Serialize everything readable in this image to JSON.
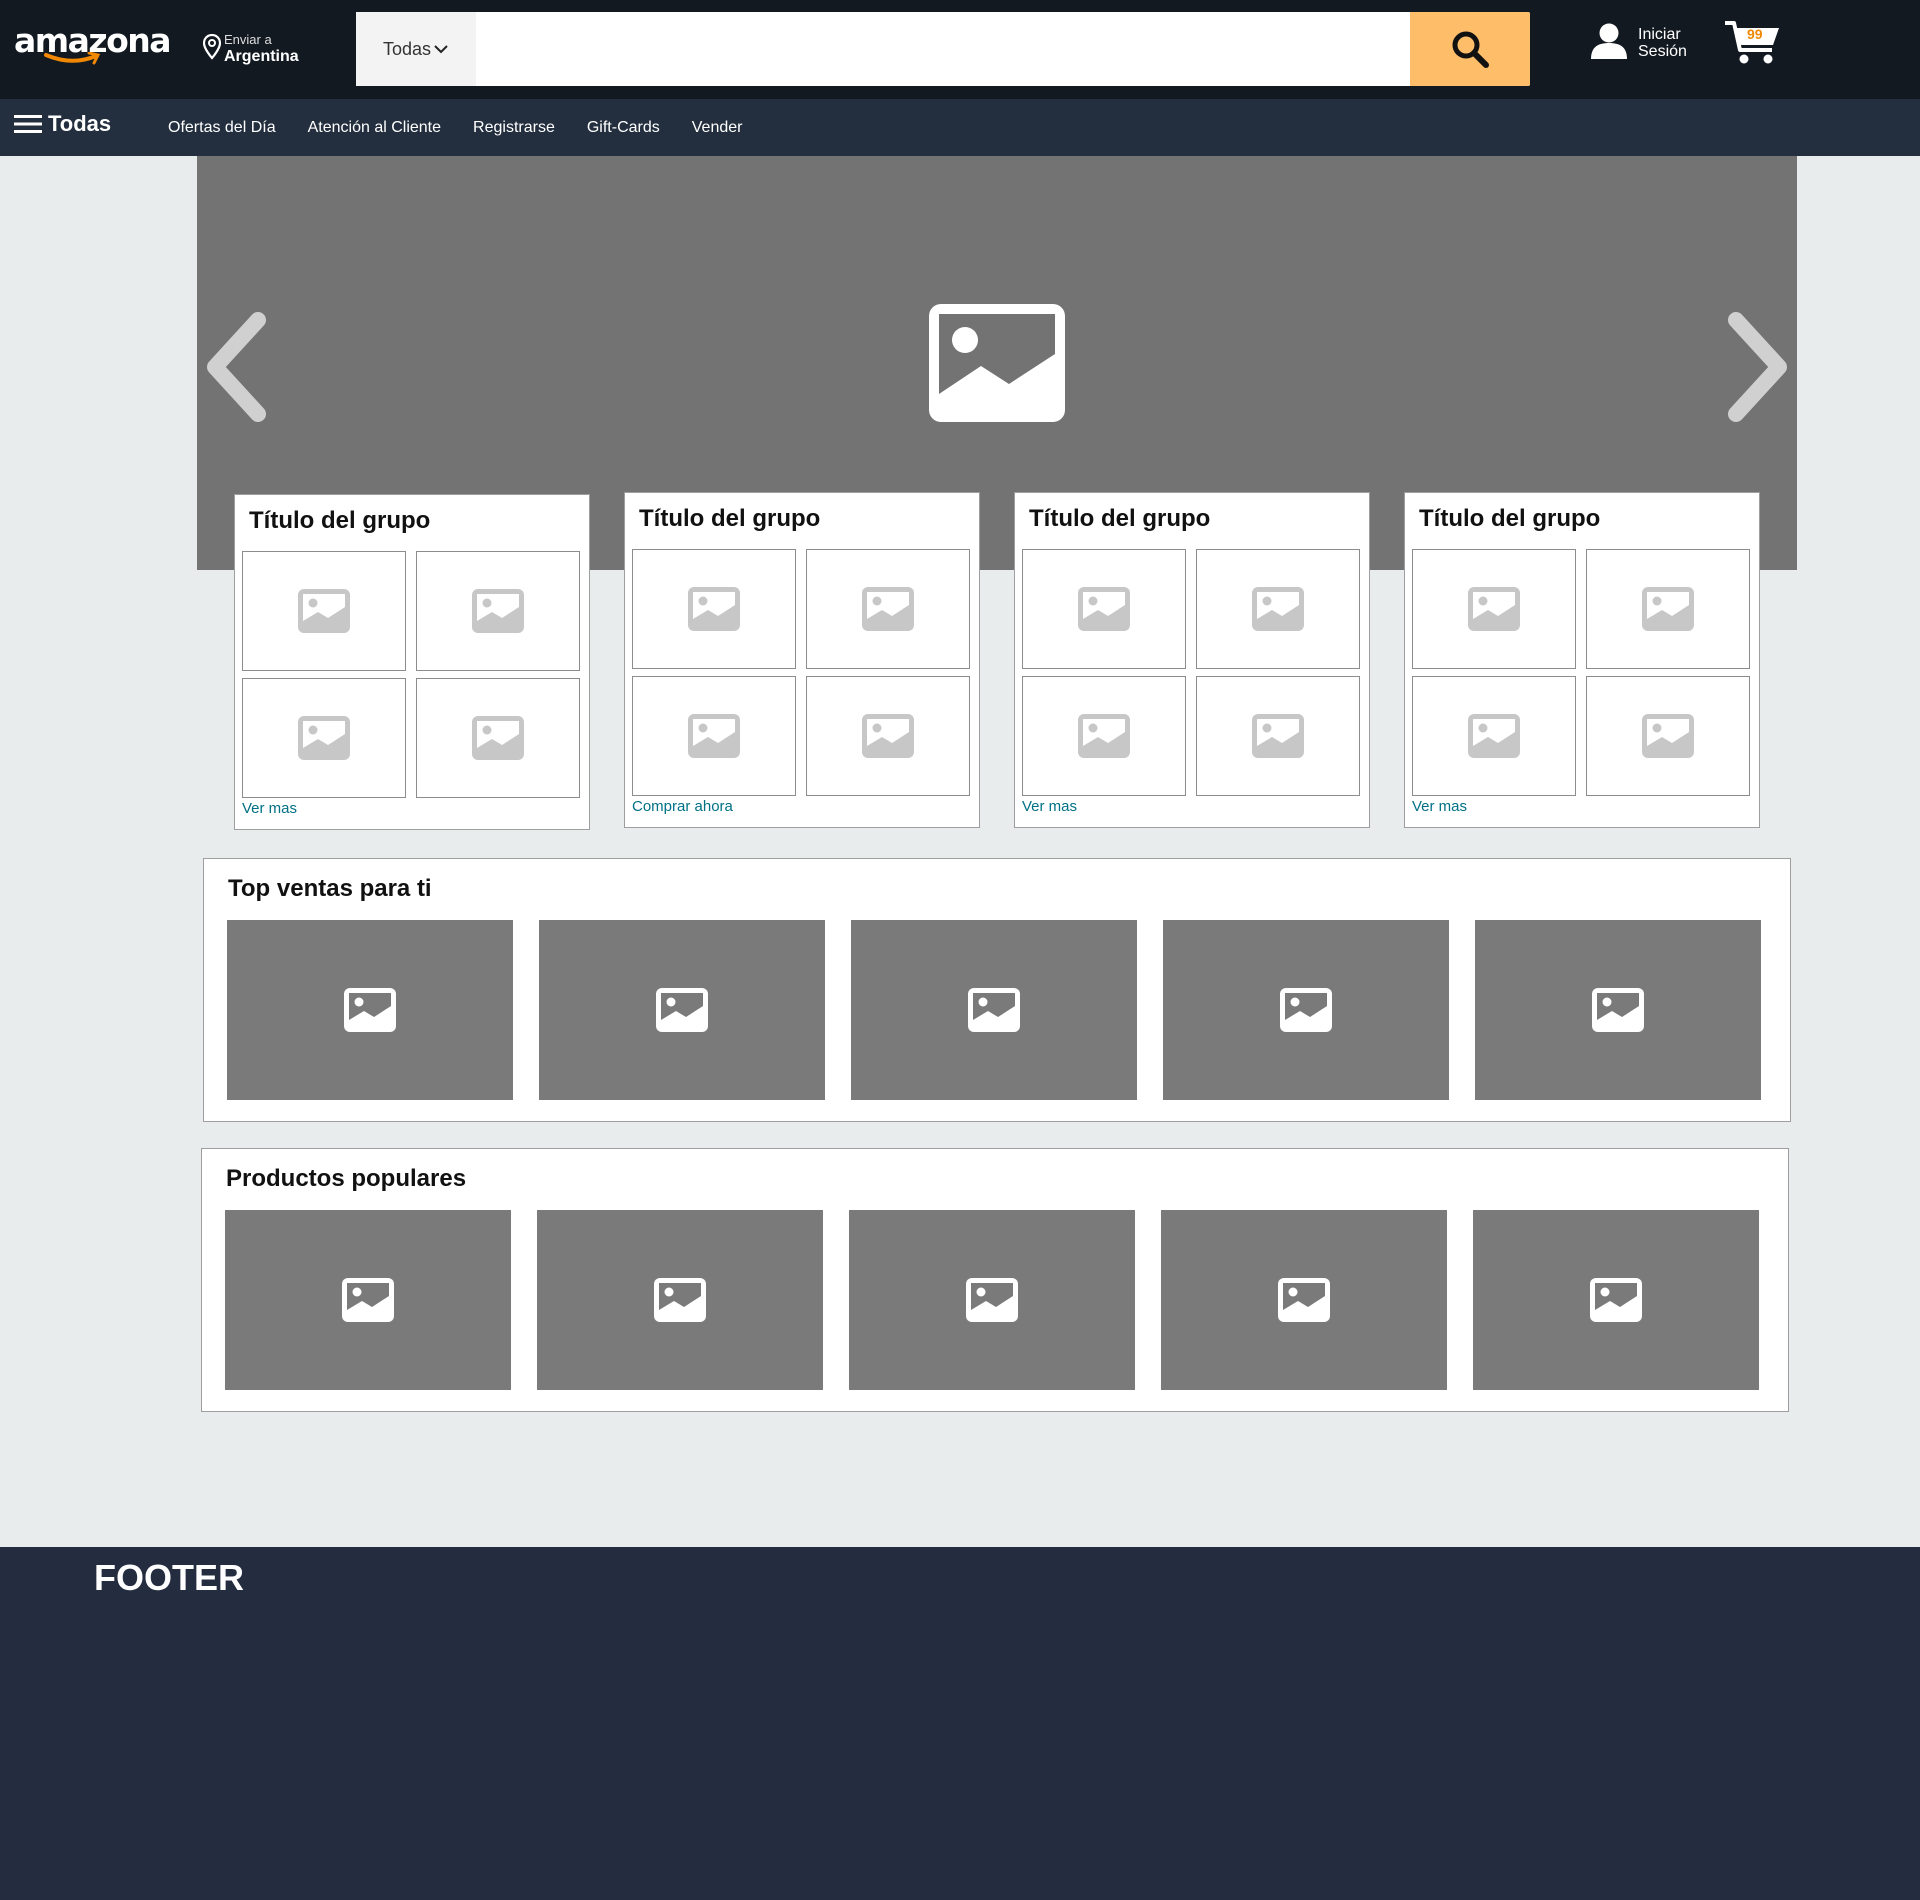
{
  "header": {
    "logo_text": "amazona",
    "deliver_label": "Enviar a",
    "deliver_country": "Argentina",
    "search_category": "Todas",
    "search_placeholder": "",
    "account_line1": "Iniciar",
    "account_line2": "Sesión",
    "cart_count": "99",
    "accent_color": "#febd69"
  },
  "nav": {
    "all_label": "Todas",
    "links": [
      "Ofertas del Día",
      "Atención al Cliente",
      "Registrarse",
      "Gift-Cards",
      "Vender"
    ]
  },
  "hero": {
    "image_icon": "image-placeholder-icon",
    "prev_icon": "chevron-left-icon",
    "next_icon": "chevron-right-icon"
  },
  "groups": [
    {
      "title": "Título del grupo",
      "link": "Ver mas"
    },
    {
      "title": "Título del grupo",
      "link": "Comprar ahora"
    },
    {
      "title": "Título del grupo",
      "link": "Ver mas"
    },
    {
      "title": "Título del grupo",
      "link": "Ver mas"
    }
  ],
  "rows": [
    {
      "title": "Top ventas para ti"
    },
    {
      "title": "Productos populares"
    }
  ],
  "footer": {
    "title": "FOOTER"
  },
  "colors": {
    "header_bg": "#131921",
    "nav_bg": "#232f3e",
    "link": "#007185",
    "footer_bg": "#232d3f"
  }
}
